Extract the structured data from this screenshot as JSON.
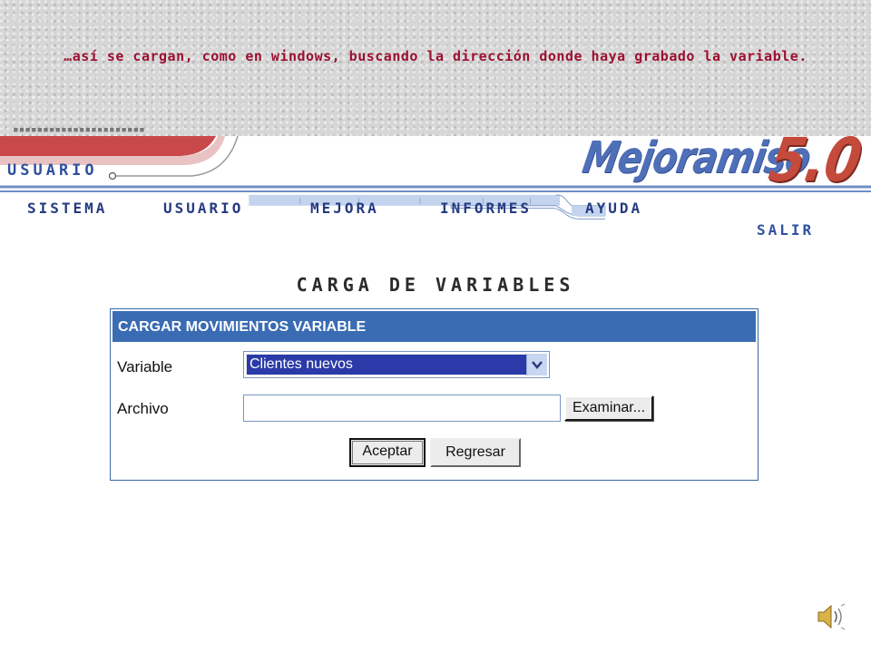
{
  "caption": {
    "text": "…así se cargan, como en windows, buscando la dirección donde haya grabado la variable."
  },
  "header": {
    "logo_word": "Mejoramiso",
    "logo_version": "5.0",
    "section_label": "USUARIO"
  },
  "menu": {
    "items": [
      "SISTEMA",
      "USUARIO",
      "MEJORA",
      "INFORMES",
      "AYUDA"
    ],
    "exit_label": "SALIR"
  },
  "page": {
    "title": "CARGA DE VARIABLES"
  },
  "form": {
    "panel_title": "CARGAR MOVIMIENTOS VARIABLE",
    "variable_label": "Variable",
    "variable_selected": "Clientes nuevos",
    "file_label": "Archivo",
    "file_value": "",
    "browse_label": "Examinar...",
    "accept_label": "Aceptar",
    "back_label": "Regresar"
  },
  "colors": {
    "caption_text": "#9b1030",
    "menu_text": "#253a80",
    "panel_header": "#3a6cb4",
    "logo_blue": "#4f6fb8",
    "logo_red": "#c44a3c"
  },
  "icons": {
    "dropdown": "chevron-down-icon",
    "audio": "speaker-icon"
  }
}
